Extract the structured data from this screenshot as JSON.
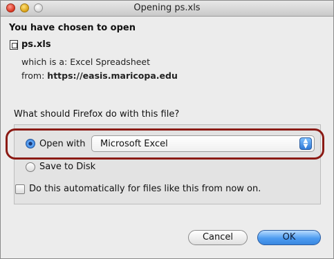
{
  "window": {
    "title": "Opening ps.xls"
  },
  "dialog": {
    "heading": "You have chosen to open",
    "file_name": "ps.xls",
    "type_prefix": "which is a:",
    "type_value": "Excel Spreadsheet",
    "from_prefix": "from:",
    "from_value": "https://easis.maricopa.edu",
    "question": "What should Firefox do with this file?"
  },
  "options": {
    "open_with_label": "Open with",
    "open_with_selected": true,
    "application": "Microsoft Excel",
    "save_to_disk_label": "Save to Disk",
    "save_to_disk_selected": false,
    "auto_label": "Do this automatically for files like this from now on.",
    "auto_checked": false
  },
  "buttons": {
    "cancel": "Cancel",
    "ok": "OK"
  },
  "colors": {
    "highlight": "#8b1a14",
    "accent": "#3a88e0"
  }
}
